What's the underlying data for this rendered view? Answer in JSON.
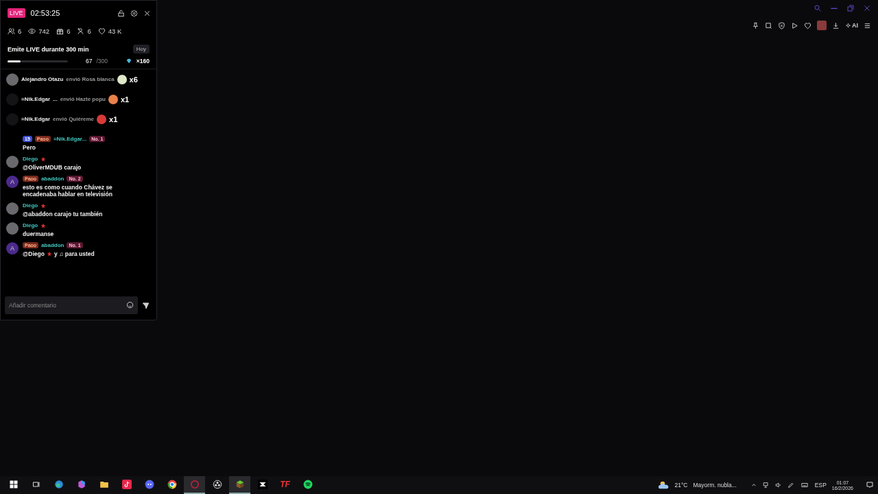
{
  "overlay": {
    "live_badge": "LIVE",
    "timer": "02:53:25",
    "stats": [
      {
        "kind": "users",
        "value": "6"
      },
      {
        "kind": "views",
        "value": "742"
      },
      {
        "kind": "gifts",
        "value": "6"
      },
      {
        "kind": "follows",
        "value": "6"
      },
      {
        "kind": "likes",
        "value": "43 K"
      }
    ],
    "goal": {
      "title": "Emite LIVE durante 300 min",
      "tag": "Hoy",
      "level": 0.22,
      "current": "67",
      "total": "/300",
      "reward": "×160"
    },
    "gift_alerts": [
      {
        "kind": "photo",
        "user": "Alejandro Otazu",
        "action": "envió Rosa blanca",
        "count": "x6",
        "color": "#dfe8c8"
      },
      {
        "kind": "dark",
        "user": "=Nik.Edgar",
        "suffix": "...",
        "action": "envió Hazte popu",
        "count": "x1",
        "color": "#e8824a"
      },
      {
        "kind": "dark",
        "user": "=Nik.Edgar",
        "action": "envió Quiéreme",
        "count": "x1",
        "color": "#d83a3a"
      }
    ],
    "messages": [
      {
        "kind": "none",
        "level": "15",
        "fan": "Paoo",
        "user": "=Nik.Edgar...",
        "rank": "No. 1",
        "star": false,
        "text": "Pero"
      },
      {
        "kind": "photo",
        "user": "Diego",
        "star": true,
        "text": "@OliverMDUB carajo"
      },
      {
        "kind": "letter",
        "avatar_letter": "A",
        "fan": "Paoo",
        "user": "abaddon",
        "rank": "No. 2",
        "star": false,
        "text": "esto es como cuando Chávez se encadenaba hablar en televisión"
      },
      {
        "kind": "photo",
        "user": "Diego",
        "star": true,
        "text": "@abaddon carajo tu también"
      },
      {
        "kind": "photo",
        "user": "Diego",
        "star": true,
        "text": "duermanse"
      },
      {
        "kind": "letter",
        "avatar_letter": "A",
        "fan": "Paoo",
        "user": "abaddon",
        "rank": "No. 1",
        "star": false,
        "mention": "@Diego",
        "text": "y ♫ para usted"
      }
    ],
    "comment": {
      "placeholder": "Añadir comentario"
    }
  },
  "browser_toolbar": {
    "ai_label": "AI"
  },
  "taskbar": {
    "apps": [
      {
        "kind": "edge",
        "selected": false
      },
      {
        "kind": "copilot",
        "selected": false
      },
      {
        "kind": "files",
        "selected": false
      },
      {
        "kind": "tiktok",
        "selected": false
      },
      {
        "kind": "discord",
        "selected": false
      },
      {
        "kind": "chrome",
        "selected": false
      },
      {
        "kind": "record",
        "selected": true
      },
      {
        "kind": "obs",
        "selected": false
      },
      {
        "kind": "minecraft",
        "selected": true
      },
      {
        "kind": "capcut",
        "selected": false
      },
      {
        "kind": "tf",
        "selected": false,
        "label": "TF"
      },
      {
        "kind": "spotify",
        "selected": false
      }
    ],
    "weather": {
      "temp": "21°C",
      "summary": "Mayorm. nubla..."
    },
    "language": "ESP",
    "time": "01:07",
    "date": "16/2/2026"
  }
}
